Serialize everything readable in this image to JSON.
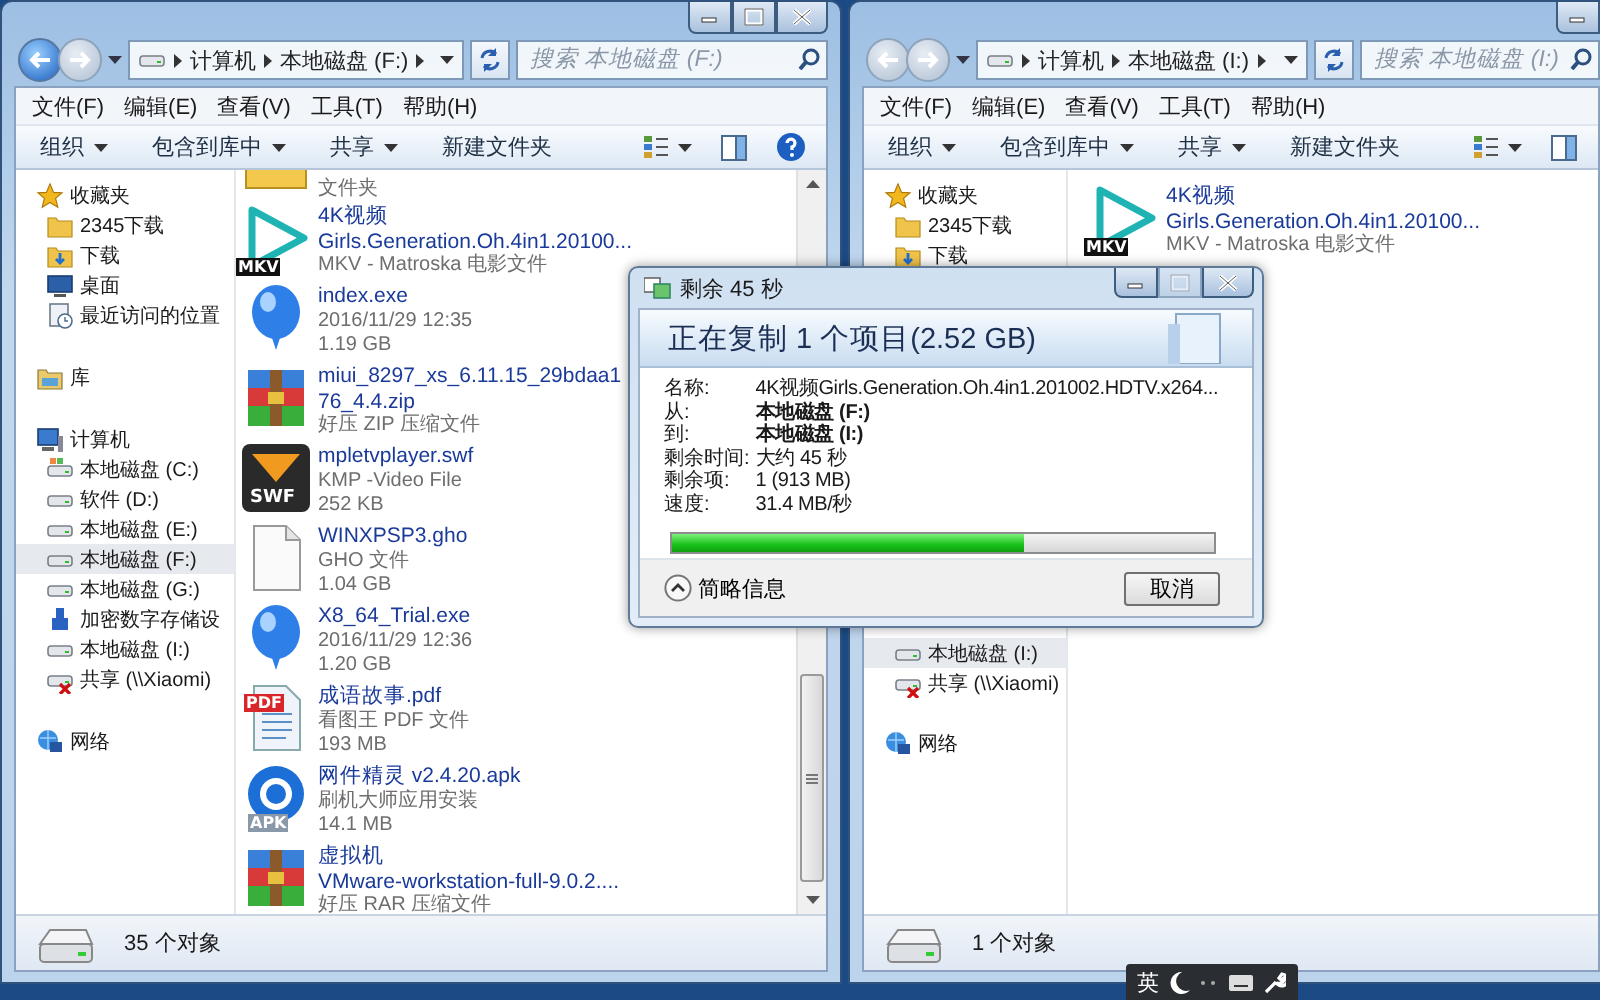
{
  "left_window": {
    "controls": [
      {
        "kind": "minimize",
        "disabled": false
      },
      {
        "kind": "maximize",
        "disabled": false
      },
      {
        "kind": "close",
        "disabled": false
      }
    ],
    "nav_buttons": [
      {
        "kind": "back",
        "disabled": false
      },
      {
        "kind": "forward",
        "disabled": true
      }
    ],
    "breadcrumb": [
      "计算机",
      "本地磁盘 (F:)"
    ],
    "search": {
      "placeholder": "搜索 本地磁盘 (F:)"
    },
    "menu": [
      "文件(F)",
      "编辑(E)",
      "查看(V)",
      "工具(T)",
      "帮助(H)"
    ],
    "toolbar": [
      {
        "label": "组织",
        "dropdown": true
      },
      {
        "label": "包含到库中",
        "dropdown": true
      },
      {
        "label": "共享",
        "dropdown": true
      },
      {
        "label": "新建文件夹",
        "dropdown": false
      }
    ],
    "sidebar": [
      {
        "label": "收藏夹",
        "kind": "favorites",
        "selected": false,
        "children": [
          {
            "label": "2345下载",
            "kind": "folder",
            "selected": false
          },
          {
            "label": "下载",
            "kind": "downloads",
            "selected": false
          },
          {
            "label": "桌面",
            "kind": "desktop",
            "selected": false
          },
          {
            "label": "最近访问的位置",
            "kind": "recent",
            "selected": false
          }
        ]
      },
      {
        "label": "库",
        "kind": "library",
        "selected": false
      },
      {
        "label": "计算机",
        "kind": "computer",
        "selected": false,
        "children": [
          {
            "label": "本地磁盘 (C:)",
            "kind": "system-drive",
            "selected": false
          },
          {
            "label": "软件 (D:)",
            "kind": "drive",
            "selected": false
          },
          {
            "label": "本地磁盘 (E:)",
            "kind": "drive",
            "selected": false
          },
          {
            "label": "本地磁盘 (F:)",
            "kind": "drive",
            "selected": true
          },
          {
            "label": "本地磁盘 (G:)",
            "kind": "drive",
            "selected": false
          },
          {
            "label": "加密数字存储设",
            "kind": "usb",
            "selected": false
          },
          {
            "label": "本地磁盘 (I:)",
            "kind": "drive",
            "selected": false
          },
          {
            "label": "共享 (\\\\Xiaomi)",
            "kind": "network-drive",
            "selected": false
          }
        ]
      },
      {
        "label": "网络",
        "kind": "network",
        "selected": false
      }
    ],
    "files": [
      {
        "kind": "folder",
        "detail_lines": [
          "文件夹"
        ]
      },
      {
        "kind": "video",
        "badge": "MKV",
        "name_lines": [
          "4K视频",
          "Girls.Generation.Oh.4in1.20100..."
        ],
        "detail_lines": [
          "MKV - Matroska 电影文件"
        ]
      },
      {
        "kind": "exe",
        "name_lines": [
          "index.exe"
        ],
        "detail_lines": [
          "2016/11/29 12:35",
          "1.19 GB"
        ]
      },
      {
        "kind": "archive",
        "name_lines": [
          "miui_8297_xs_6.11.15_29bdaa1",
          "76_4.4.zip"
        ],
        "detail_lines": [
          "好压 ZIP 压缩文件"
        ]
      },
      {
        "kind": "media",
        "badge": "SWF",
        "name_lines": [
          "mpletvplayer.swf"
        ],
        "detail_lines": [
          "KMP -Video File",
          "252 KB"
        ]
      },
      {
        "kind": "file",
        "name_lines": [
          "WINXPSP3.gho"
        ],
        "detail_lines": [
          "GHO 文件",
          "1.04 GB"
        ]
      },
      {
        "kind": "exe",
        "name_lines": [
          "X8_64_Trial.exe"
        ],
        "detail_lines": [
          "2016/11/29 12:36",
          "1.20 GB"
        ]
      },
      {
        "kind": "pdf",
        "badge": "PDF",
        "name_lines": [
          "成语故事.pdf"
        ],
        "detail_lines": [
          "看图王 PDF 文件",
          "193 MB"
        ]
      },
      {
        "kind": "apk",
        "badge": "APK",
        "name_lines": [
          "网件精灵 v2.4.20.apk"
        ],
        "detail_lines": [
          "刷机大师应用安装",
          "14.1 MB"
        ]
      },
      {
        "kind": "archive",
        "name_lines": [
          "虚拟机",
          "VMware-workstation-full-9.0.2...."
        ],
        "detail_lines": [
          "好压 RAR 压缩文件"
        ]
      }
    ],
    "has_scrollbar": true,
    "status": "35 个对象"
  },
  "right_window": {
    "controls": [
      {
        "kind": "minimize",
        "disabled": false
      }
    ],
    "nav_buttons": [
      {
        "kind": "back",
        "disabled": true
      },
      {
        "kind": "forward",
        "disabled": true
      }
    ],
    "breadcrumb": [
      "计算机",
      "本地磁盘 (I:)"
    ],
    "search": {
      "placeholder": "搜索 本地磁盘 (I:)"
    },
    "menu": [
      "文件(F)",
      "编辑(E)",
      "查看(V)",
      "工具(T)",
      "帮助(H)"
    ],
    "toolbar": [
      {
        "label": "组织",
        "dropdown": true
      },
      {
        "label": "包含到库中",
        "dropdown": true
      },
      {
        "label": "共享",
        "dropdown": true
      },
      {
        "label": "新建文件夹",
        "dropdown": false
      }
    ],
    "sidebar": [
      {
        "label": "收藏夹",
        "kind": "favorites",
        "selected": false,
        "children": [
          {
            "label": "2345下载",
            "kind": "folder",
            "selected": false
          },
          {
            "label": "下载",
            "kind": "downloads",
            "selected": false
          }
        ]
      }
    ],
    "sidebar_lower": {
      "items": [
        {
          "label": "本地磁盘 (I:)",
          "kind": "drive",
          "selected": true
        },
        {
          "label": "共享 (\\\\Xiaomi)",
          "kind": "network-drive",
          "selected": false
        }
      ],
      "sections": [
        {
          "label": "网络",
          "kind": "network",
          "selected": false
        }
      ]
    },
    "files": [
      {
        "kind": "video",
        "badge": "MKV",
        "name_lines": [
          "4K视频",
          "Girls.Generation.Oh.4in1.20100..."
        ],
        "detail_lines": [
          "MKV - Matroska 电影文件"
        ]
      }
    ],
    "has_scrollbar": false,
    "status": "1 个对象"
  },
  "copy_dialog": {
    "title": "剩余 45 秒",
    "controls": [
      {
        "kind": "minimize",
        "disabled": false
      },
      {
        "kind": "maximize",
        "disabled": true
      },
      {
        "kind": "close",
        "disabled": false
      }
    ],
    "heading": "正在复制 1 个项目(2.52 GB)",
    "details": [
      {
        "label": "名称:",
        "value": "4K视频Girls.Generation.Oh.4in1.201002.HDTV.x264...",
        "bold": false
      },
      {
        "label": "从:",
        "value": "本地磁盘 (F:)",
        "bold": true
      },
      {
        "label": "到:",
        "value": "本地磁盘 (I:)",
        "bold": true
      },
      {
        "label": "剩余时间:",
        "value": "大约 45 秒",
        "bold": false
      },
      {
        "label": "剩余项:",
        "value": "1 (913 MB)",
        "bold": false
      },
      {
        "label": "速度:",
        "value": "31.4 MB/秒",
        "bold": false
      }
    ],
    "progress": {
      "level": 0.65
    },
    "toggle": {
      "label": "简略信息",
      "expanded": true
    },
    "cancel_button": "取消"
  },
  "ime_bar": {
    "label": "英"
  }
}
